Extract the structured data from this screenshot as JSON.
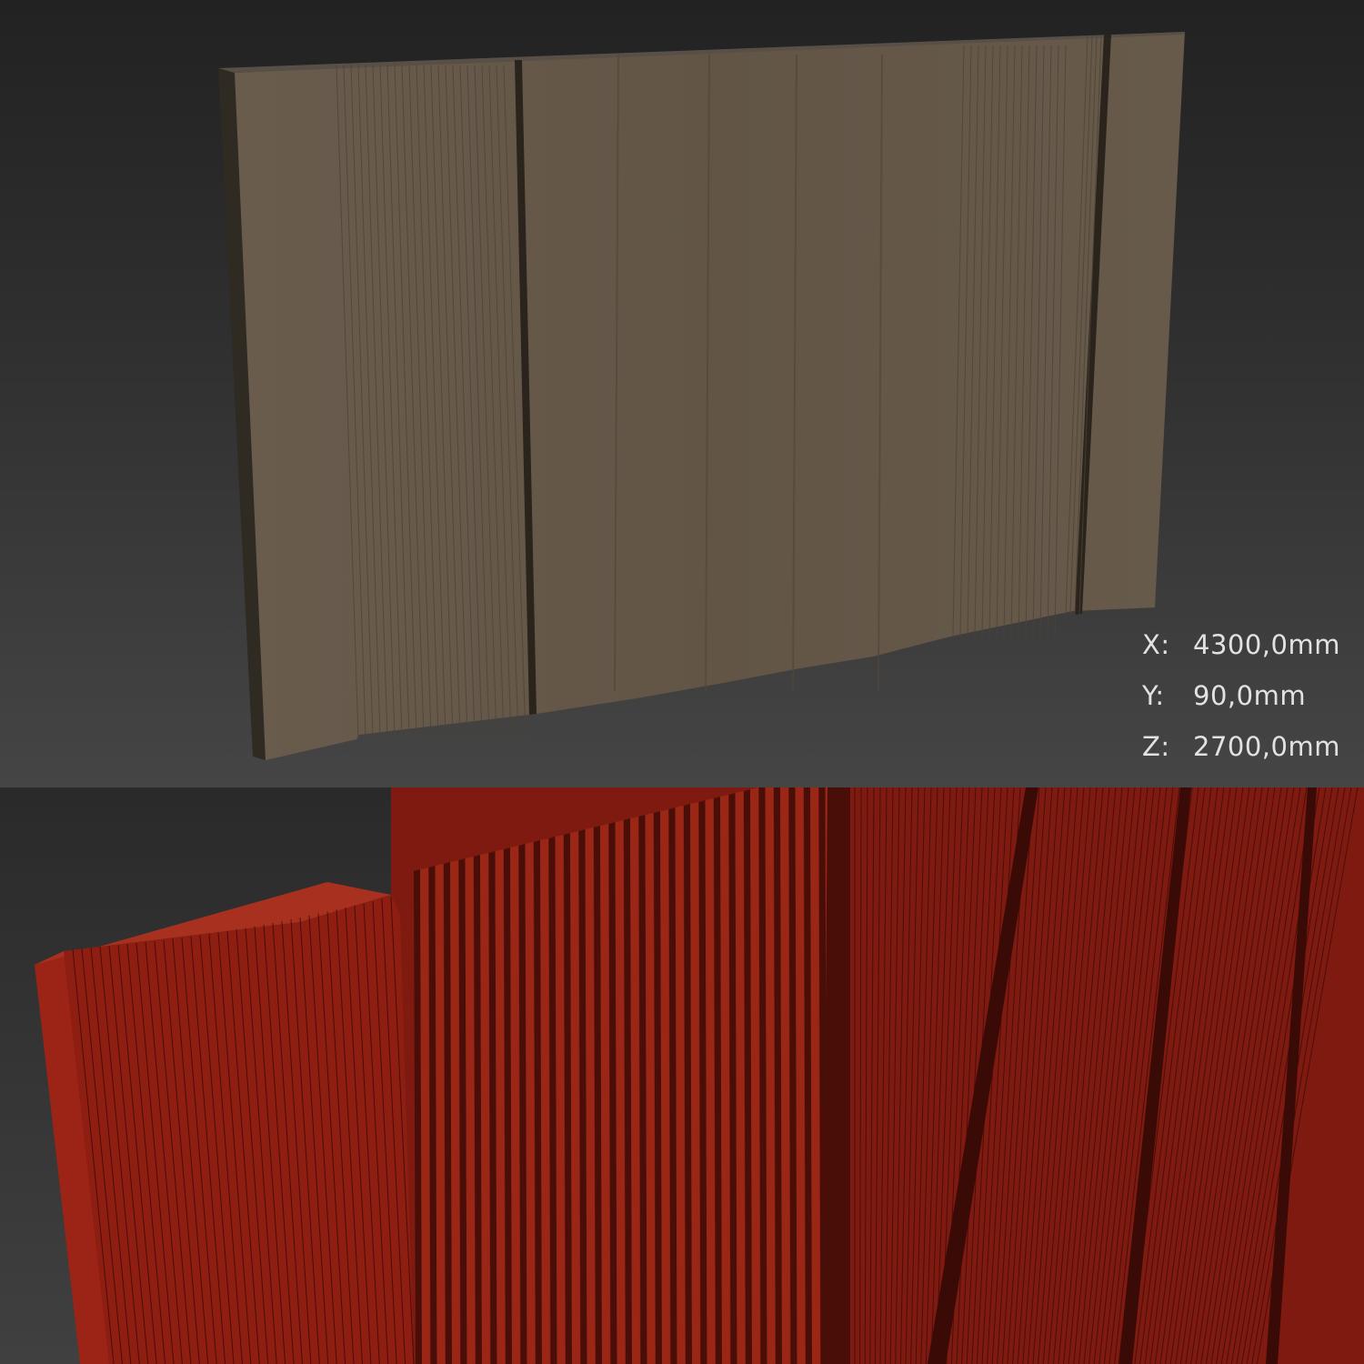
{
  "dimensions": [
    {
      "axis": "X:",
      "value": "4300,0mm"
    },
    {
      "axis": "Y:",
      "value": "90,0mm"
    },
    {
      "axis": "Z:",
      "value": "2700,0mm"
    }
  ],
  "colors": {
    "wood": "#655749",
    "wood_dark": "#3a3226",
    "wireframe": "#8a1c12",
    "wireframe_line": "#2a0604"
  }
}
